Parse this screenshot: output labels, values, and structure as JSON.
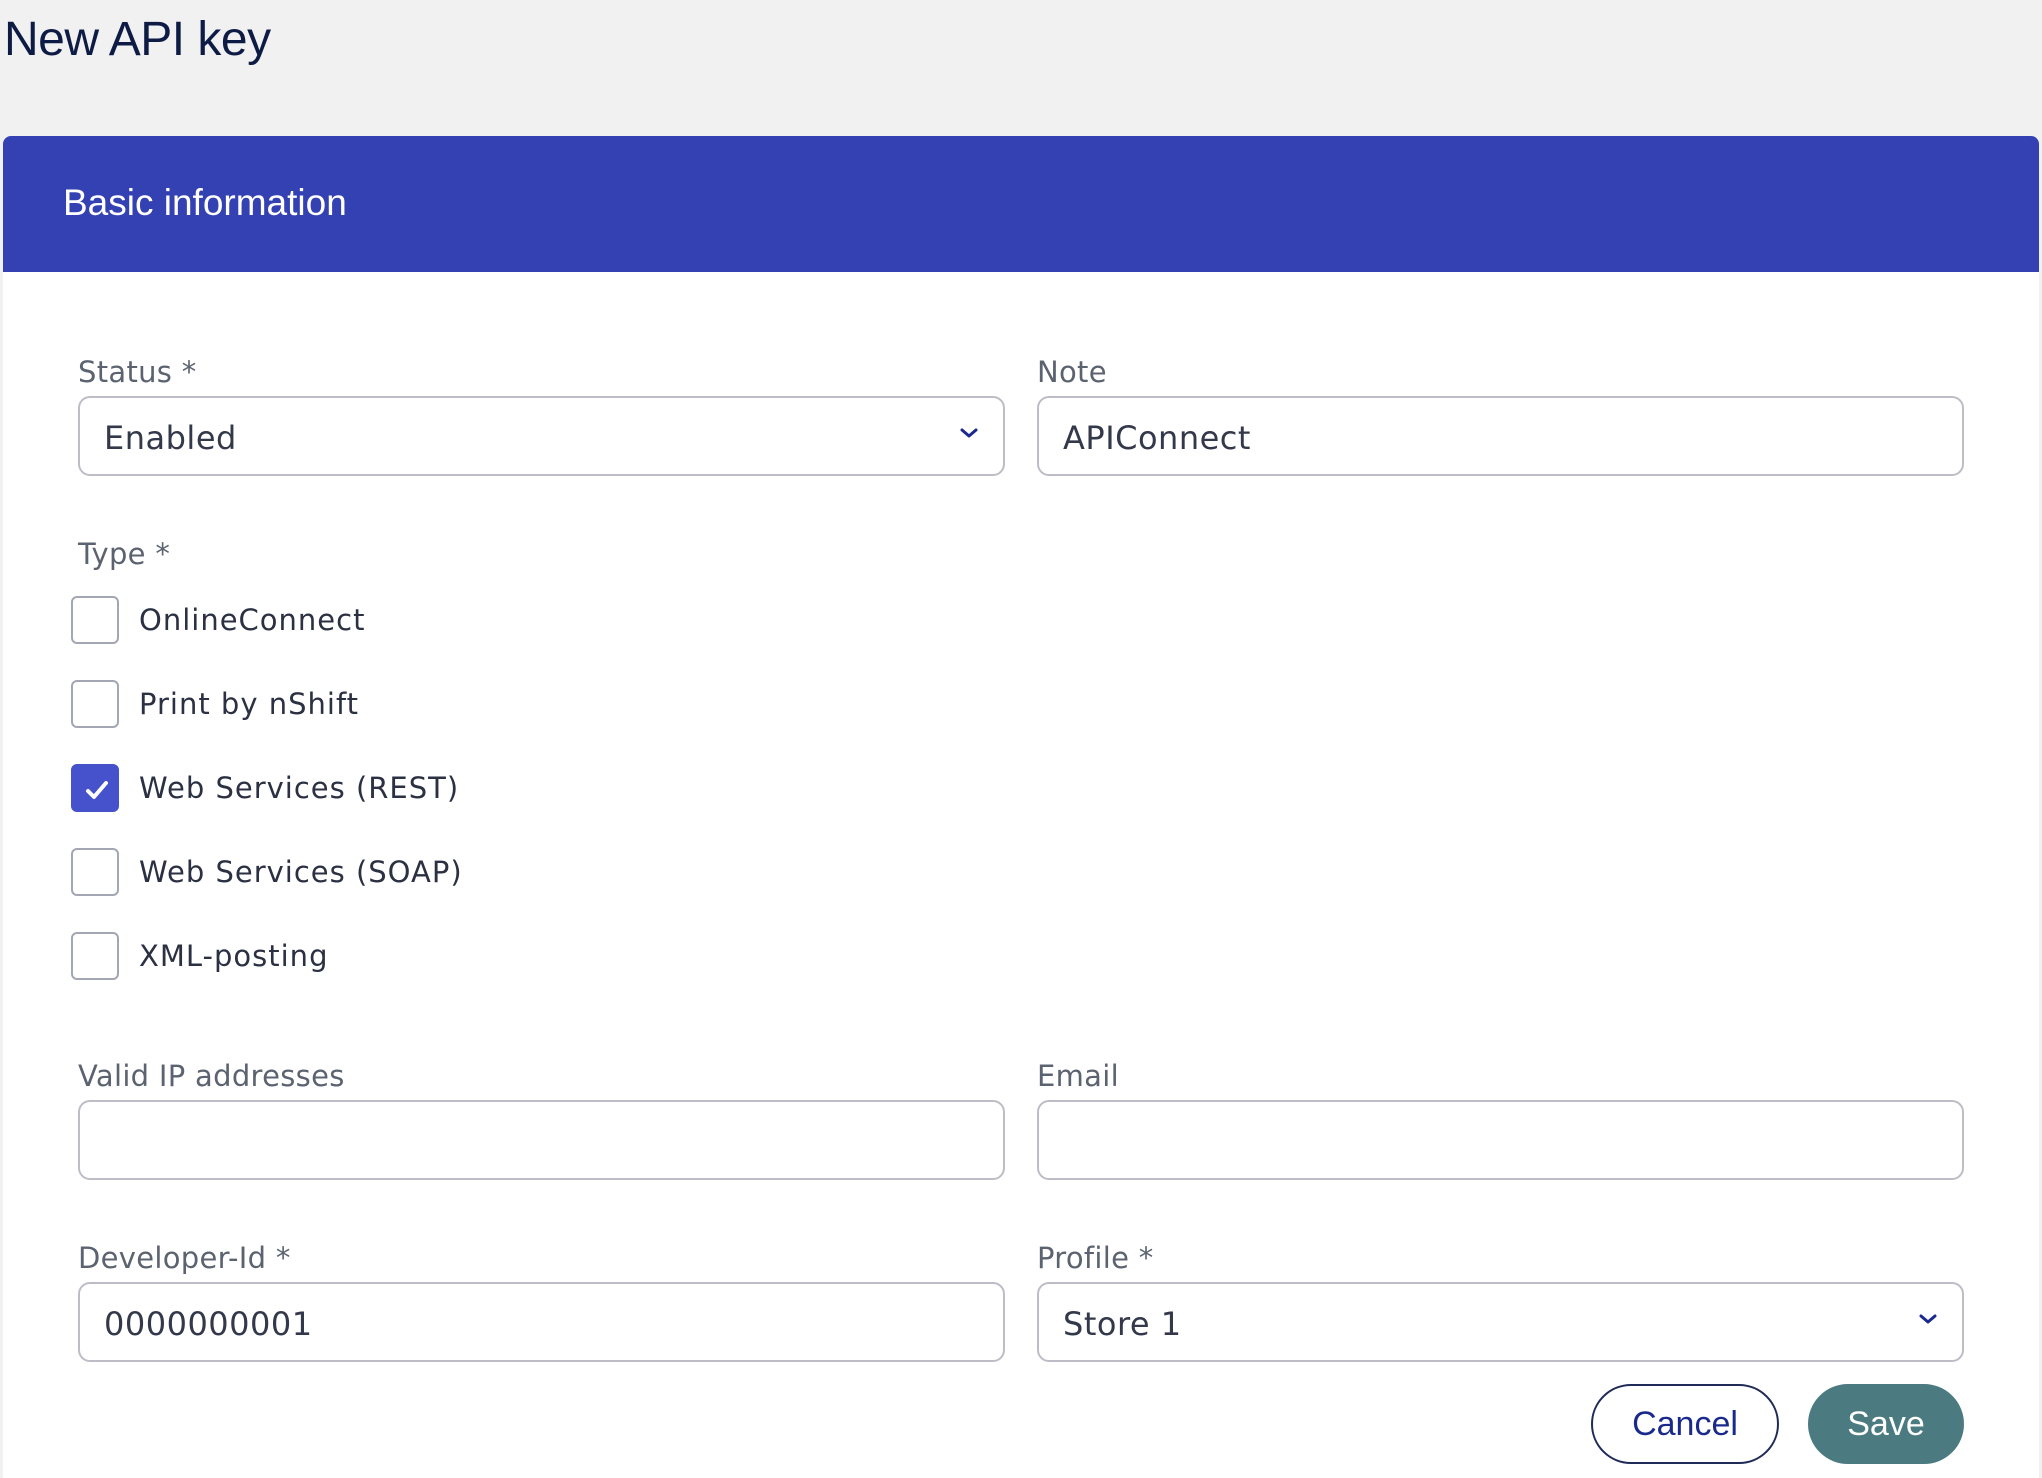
{
  "page": {
    "title": "New API key"
  },
  "section": {
    "title": "Basic information"
  },
  "status": {
    "label": "Status *",
    "value": "Enabled"
  },
  "note": {
    "label": "Note",
    "value": "APIConnect"
  },
  "type": {
    "label": "Type *",
    "options": [
      {
        "label": "OnlineConnect",
        "checked": false
      },
      {
        "label": "Print by nShift",
        "checked": false
      },
      {
        "label": "Web Services (REST)",
        "checked": true
      },
      {
        "label": "Web Services (SOAP)",
        "checked": false
      },
      {
        "label": "XML-posting",
        "checked": false
      }
    ]
  },
  "valid_ip": {
    "label": "Valid IP addresses",
    "value": ""
  },
  "email": {
    "label": "Email",
    "value": ""
  },
  "developer_id": {
    "label": "Developer-Id *",
    "value": "0000000001"
  },
  "profile": {
    "label": "Profile *",
    "value": "Store 1"
  },
  "actions": {
    "cancel_label": "Cancel",
    "save_label": "Save"
  },
  "colors": {
    "header_bg": "#3441b3",
    "checkbox_checked": "#4651cc",
    "save_button": "#4b7b80",
    "cancel_text": "#1a2a8c"
  }
}
